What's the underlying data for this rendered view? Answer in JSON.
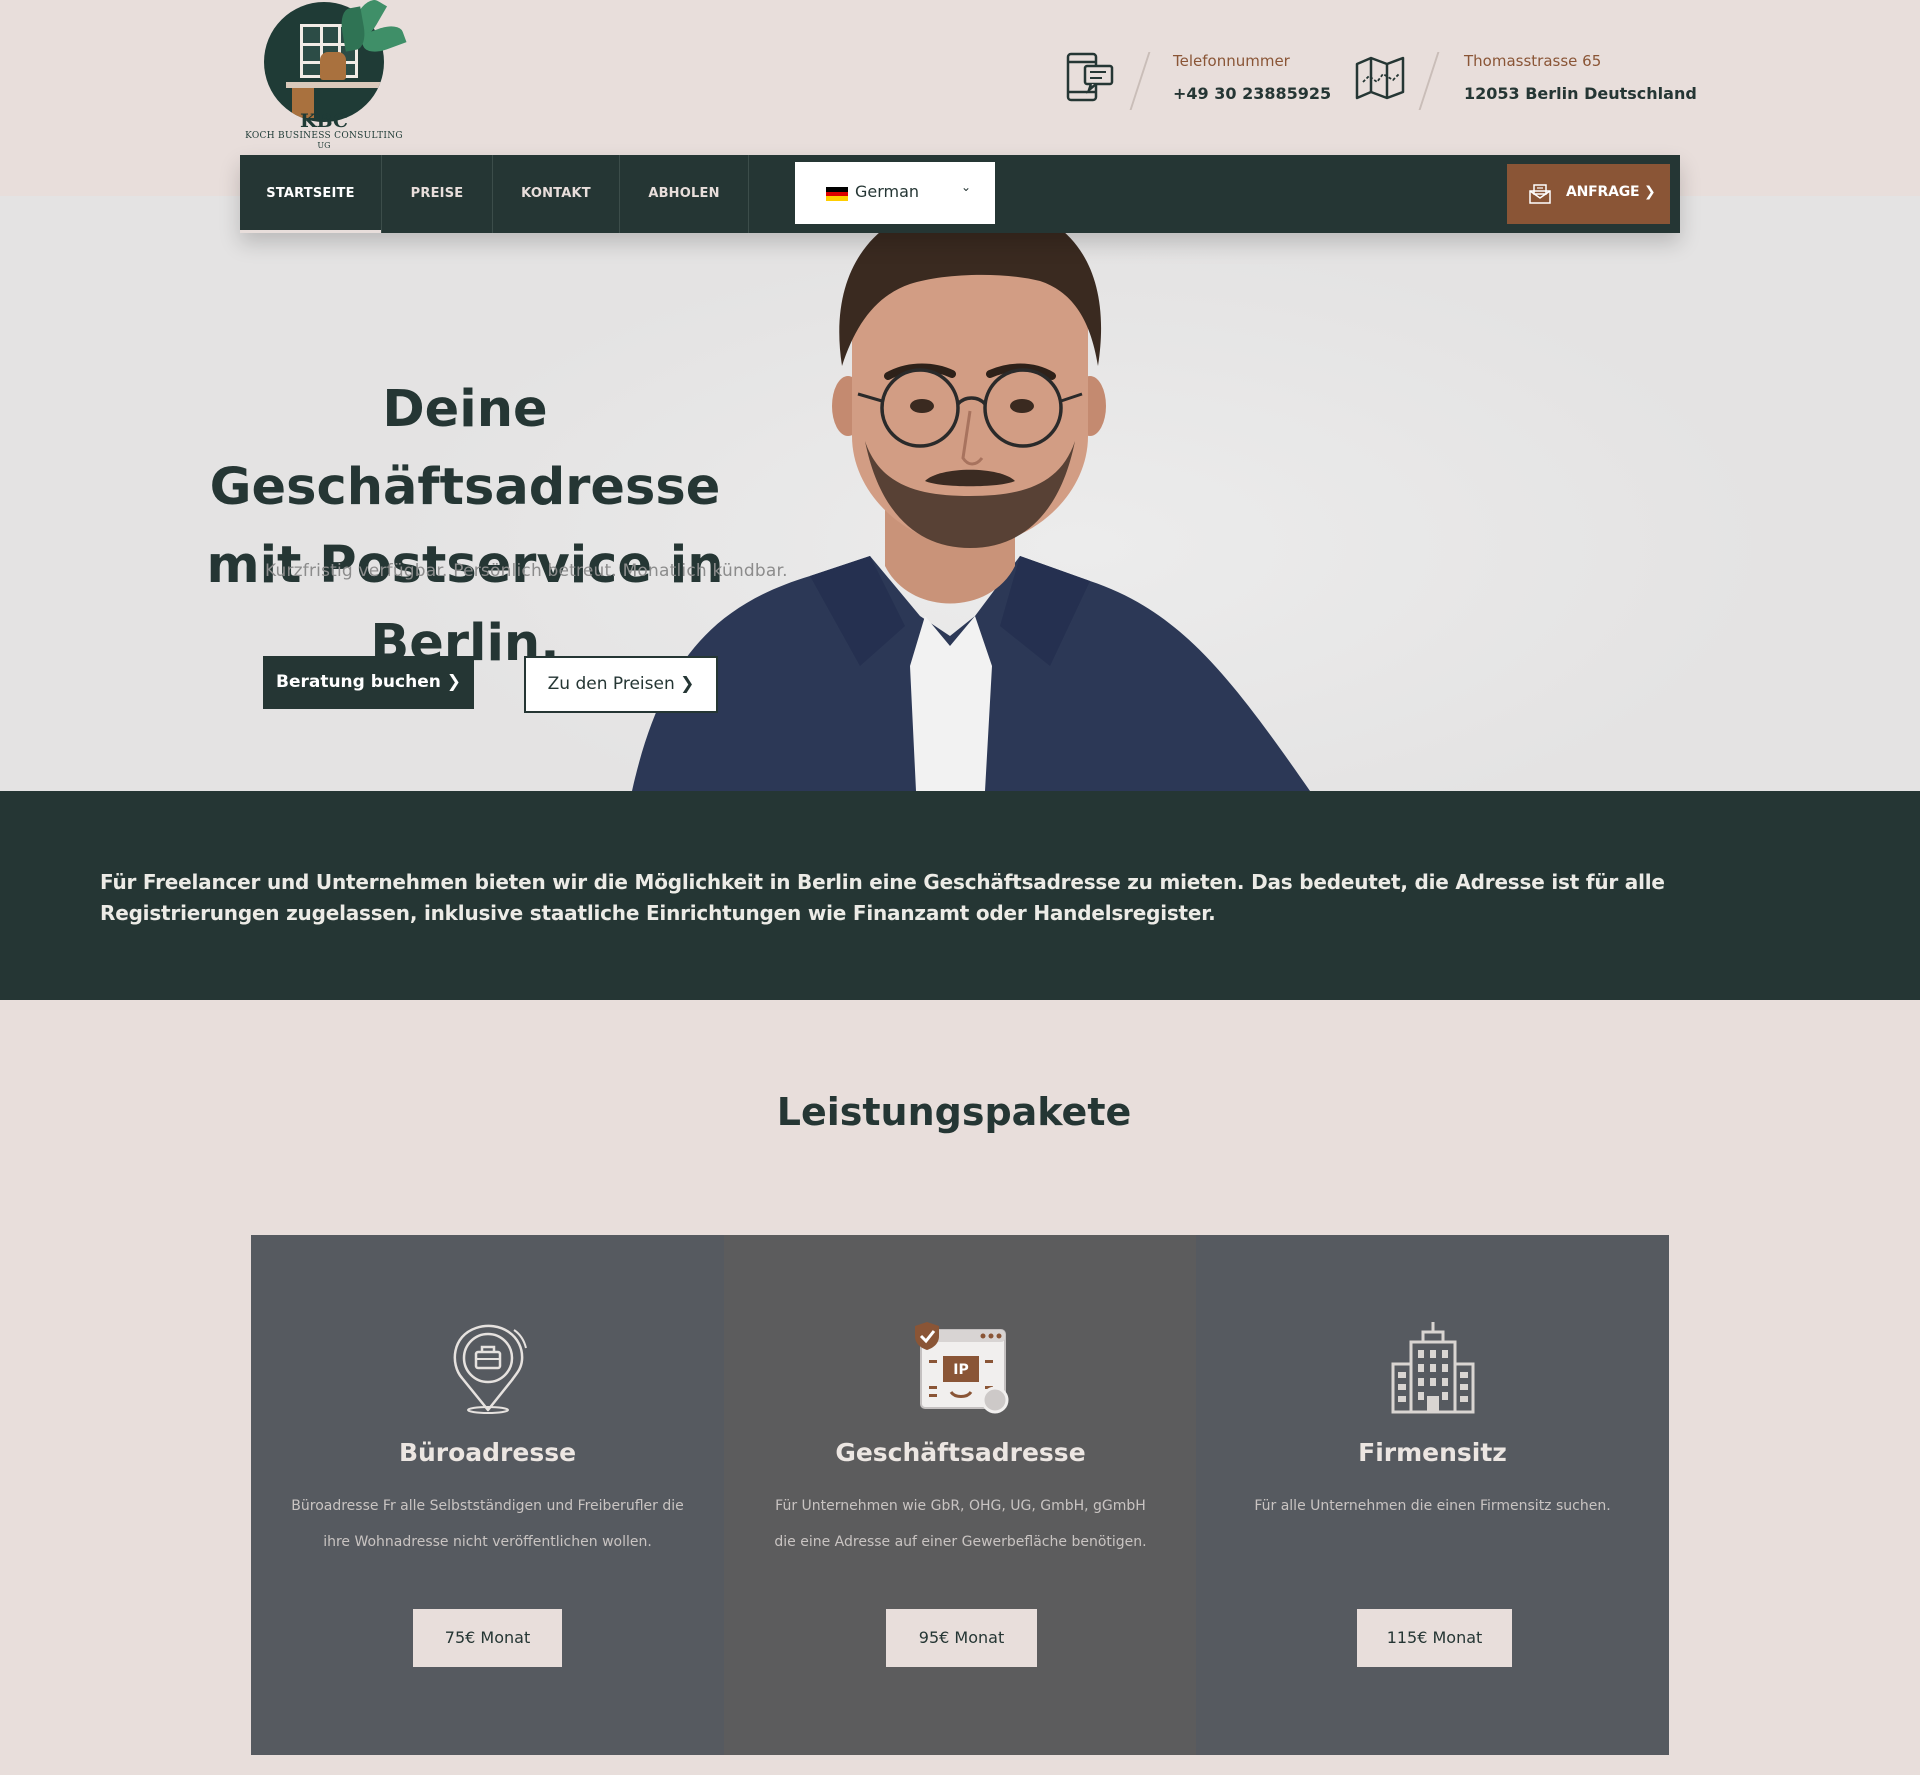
{
  "header": {
    "logo_text": "KBC",
    "logo_subtitle": "KOCH BUSINESS CONSULTING",
    "logo_subtitle2": "UG",
    "phone_label": "Telefonnummer",
    "phone_value": "+49 30 23885925",
    "address_label": "Thomasstrasse 65",
    "address_value": "12053 Berlin Deutschland"
  },
  "nav": {
    "items": [
      {
        "label": "STARTSEITE",
        "active": true
      },
      {
        "label": "PREISE",
        "active": false
      },
      {
        "label": "KONTAKT",
        "active": false
      },
      {
        "label": "ABHOLEN",
        "active": false
      }
    ],
    "language": "German",
    "cta_label": "ANFRAGE ❯"
  },
  "hero": {
    "title_line1": "Deine Geschäftsadresse",
    "title_line2": "mit Postservice in Berlin.",
    "subtitle": "Kurzfristig verfügbar. Persönlich betreut. Monatlich kündbar.",
    "primary_button": "Beratung buchen ❯",
    "secondary_button": "Zu den Preisen ❯"
  },
  "banner": {
    "text": "Für Freelancer und Unternehmen bieten wir die Möglichkeit in Berlin eine Geschäftsadresse zu mieten. Das bedeutet, die Adresse ist für alle Registrierungen zugelassen, inklusive staatliche Einrichtungen wie Finanzamt oder Handelsregister."
  },
  "packages": {
    "title": "Leistungspakete",
    "items": [
      {
        "icon": "location-briefcase-icon",
        "title": "Büroadresse",
        "description": "Büroadresse Fr alle Selbstständigen und Freiberufler die ihre Wohnadresse nicht veröffentlichen wollen.",
        "price": "75€ Monat"
      },
      {
        "icon": "ip-address-icon",
        "title": "Geschäftsadresse",
        "description": "Für Unternehmen wie GbR, OHG, UG, GmbH, gGmbH die eine Adresse auf einer Gewerbefläche benötigen.",
        "price": "95€ Monat"
      },
      {
        "icon": "office-building-icon",
        "title": "Firmensitz",
        "description": "Für alle Unternehmen die einen Firmensitz suchen.",
        "price": "115€ Monat"
      }
    ]
  },
  "colors": {
    "page_bg": "#e8dedb",
    "dark_green": "#253634",
    "brown_accent": "#8a5536",
    "hero_bg": "#e4e3e3",
    "card_dark": "#565a60",
    "card_mid": "#5c5c5d"
  }
}
